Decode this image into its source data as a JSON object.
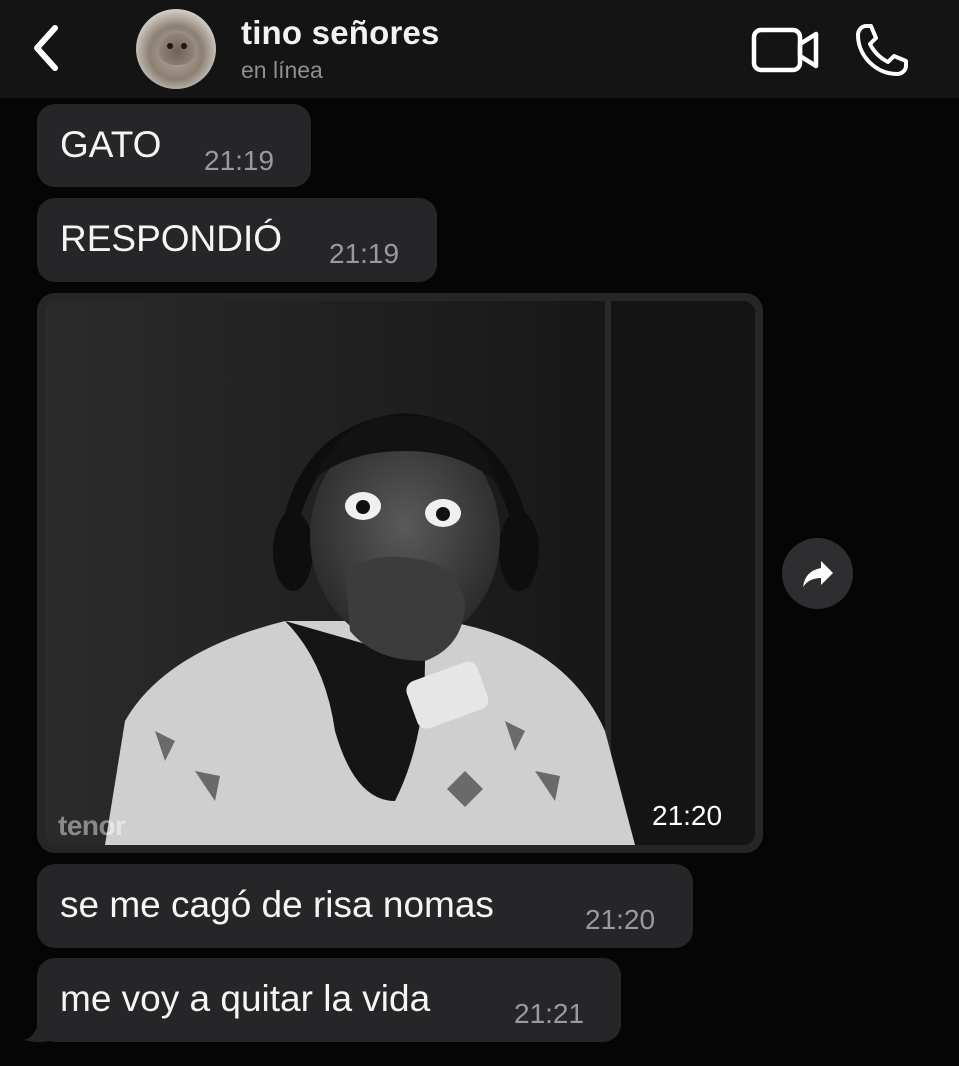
{
  "header": {
    "contact_name": "tino señores",
    "status": "en línea"
  },
  "messages": [
    {
      "text": "GATO",
      "time": "21:19"
    },
    {
      "text": "RESPONDIÓ",
      "time": "21:19"
    },
    {
      "text": "se me cagó de risa nomas",
      "time": "21:20"
    },
    {
      "text": "me voy a quitar la vida",
      "time": "21:21"
    }
  ],
  "gif_message": {
    "time": "21:20",
    "watermark": "tenor"
  },
  "colors": {
    "background": "#050505",
    "header": "#141414",
    "bubble": "#262628",
    "timestamp": "#9a9a9e"
  },
  "icons": {
    "back": "chevron-left-icon",
    "video": "video-camera-icon",
    "call": "phone-icon",
    "share": "share-arrow-icon"
  }
}
